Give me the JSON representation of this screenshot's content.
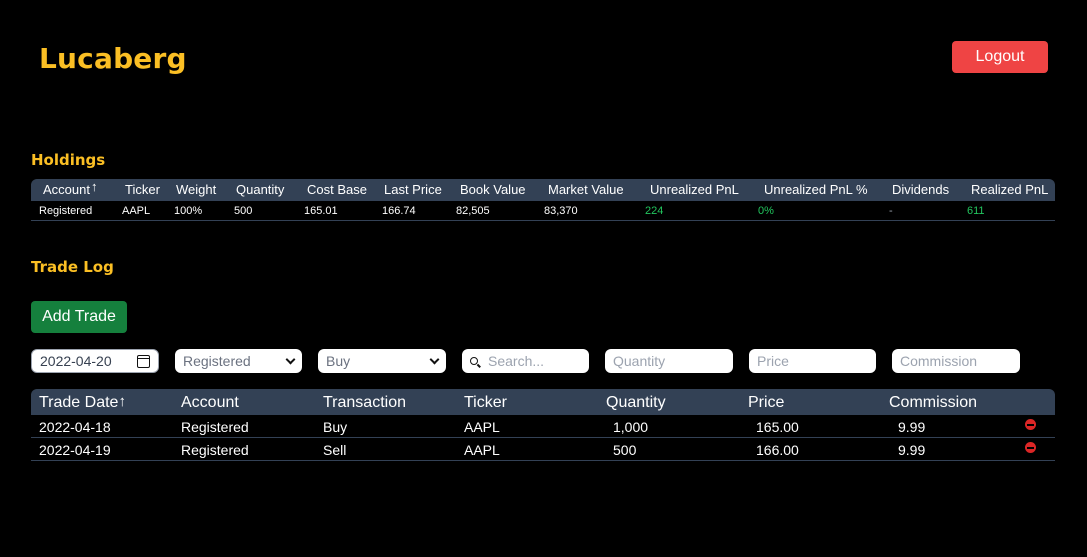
{
  "app": {
    "brand": "Lucaberg",
    "logout_label": "Logout"
  },
  "holdings": {
    "title": "Holdings",
    "columns": [
      "Account",
      "Ticker",
      "Weight",
      "Quantity",
      "Cost Base",
      "Last Price",
      "Book Value",
      "Market Value",
      "Unrealized PnL",
      "Unrealized PnL %",
      "Dividends",
      "Realized PnL"
    ],
    "sort_indicator": "↑",
    "rows": [
      [
        "Registered",
        "AAPL",
        "100%",
        "500",
        "165.01",
        "166.74",
        "82,505",
        "83,370",
        "224",
        "0%",
        "-",
        "611"
      ]
    ],
    "colors": {
      "positive": "#22c55e",
      "header_bg": "#334155"
    }
  },
  "trade_log": {
    "title": "Trade Log",
    "add_button_label": "Add Trade",
    "form": {
      "date_value": "2022-04-20",
      "account_value": "Registered",
      "transaction_value": "Buy",
      "search_placeholder": "Search...",
      "quantity_placeholder": "Quantity",
      "price_placeholder": "Price",
      "commission_placeholder": "Commission"
    },
    "columns": [
      "Trade Date",
      "Account",
      "Transaction",
      "Ticker",
      "Quantity",
      "Price",
      "Commission"
    ],
    "sort_indicator": "↑",
    "rows": [
      [
        "2022-04-18",
        "Registered",
        "Buy",
        "AAPL",
        "1,000",
        "165.00",
        "9.99"
      ],
      [
        "2022-04-19",
        "Registered",
        "Sell",
        "AAPL",
        "500",
        "166.00",
        "9.99"
      ]
    ]
  },
  "colors": {
    "brand": "#fbbf24",
    "logout": "#ef4444",
    "add_trade": "#15803d",
    "delete": "#dc2626"
  }
}
